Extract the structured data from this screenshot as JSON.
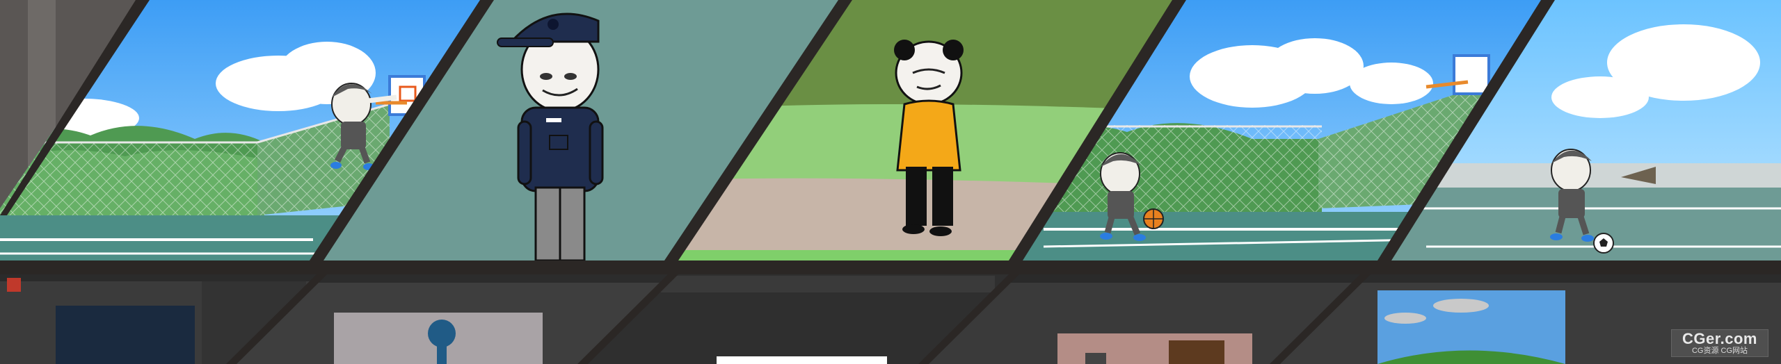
{
  "watermark": {
    "brand": "CGer.com",
    "tagline": "CG资源 CG网站"
  },
  "colors": {
    "frame": "#2b2725",
    "sky": "#63b7ff",
    "grass": "#92cf7a",
    "court": "#6e9b95",
    "editor_bg": "#3a3a3a",
    "editor_panel": "#2f2f2f",
    "shirt_yellow": "#f4a818",
    "uniform_navy": "#1f2d4e"
  },
  "icons": [
    "basketball-icon",
    "soccer-ball-icon",
    "basketball-hoop-icon"
  ]
}
